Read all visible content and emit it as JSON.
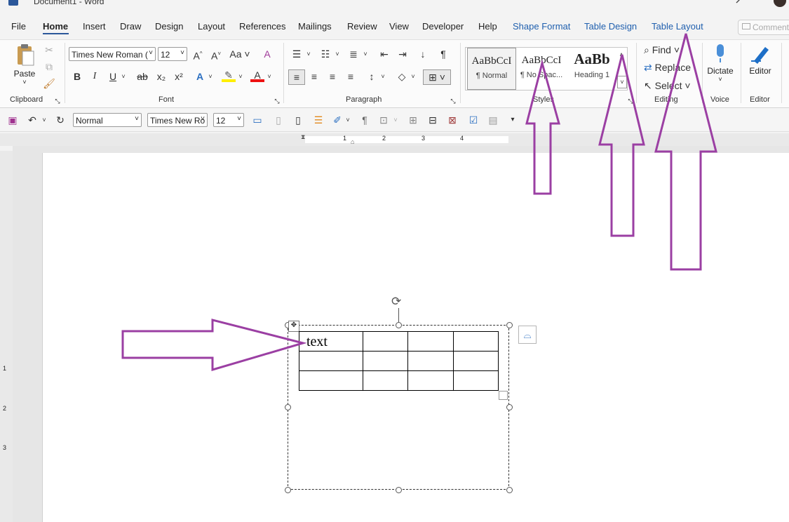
{
  "window": {
    "title": "Document1 - Word"
  },
  "tabs": [
    "File",
    "Home",
    "Insert",
    "Draw",
    "Design",
    "Layout",
    "References",
    "Mailings",
    "Review",
    "View",
    "Developer",
    "Help",
    "Shape Format",
    "Table Design",
    "Table Layout"
  ],
  "active_tab": "Home",
  "comments_label": "Comments",
  "ribbon": {
    "clipboard": {
      "label": "Clipboard",
      "paste": "Paste"
    },
    "font": {
      "label": "Font",
      "family": "Times New Roman (",
      "size": "12",
      "bold": "B",
      "italic": "I",
      "underline": "U",
      "strike": "ab",
      "sub": "x₂",
      "sup": "x²",
      "grow": "A^",
      "shrink": "A˅",
      "case": "Aa"
    },
    "paragraph": {
      "label": "Paragraph"
    },
    "styles": {
      "label": "Styles",
      "items": [
        {
          "sample": "AaBbCcI",
          "name": "¶ Normal"
        },
        {
          "sample": "AaBbCcI",
          "name": "¶ No Spac..."
        },
        {
          "sample": "AaBb",
          "name": "Heading 1"
        }
      ]
    },
    "editing": {
      "label": "Editing",
      "find": "Find",
      "replace": "Replace",
      "select": "Select"
    },
    "voice": {
      "label": "Voice",
      "dictate": "Dictate"
    },
    "editor": {
      "label": "Editor",
      "editor_btn": "Editor"
    }
  },
  "qat": {
    "style": "Normal",
    "font": "Times New Ro",
    "size": "12"
  },
  "ruler": {
    "marks": [
      "1",
      "2",
      "3",
      "4"
    ]
  },
  "vruler": {
    "marks": [
      "1",
      "2",
      "3"
    ]
  },
  "document": {
    "cell_text": "text"
  },
  "colors": {
    "accent": "#2b579a",
    "annotation": "#9b3fa3",
    "tab_blue": "#1f5fae"
  }
}
